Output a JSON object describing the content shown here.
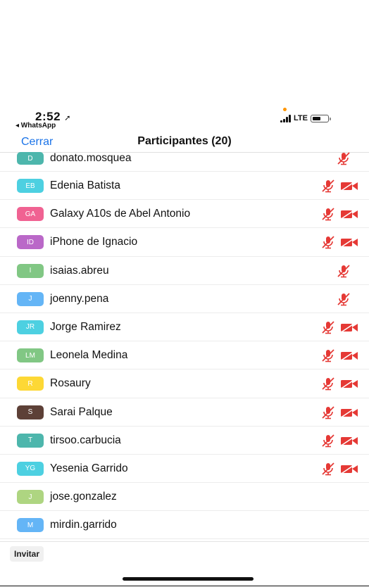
{
  "status": {
    "time": "2:52",
    "location_glyph": "➚",
    "back_app": "◂ WhatsApp",
    "network": "LTE",
    "battery_level": 0.55
  },
  "nav": {
    "close_label": "Cerrar",
    "title": "Participantes (20)"
  },
  "colors": {
    "accent": "#1a73e8",
    "muted_red": "#e53935"
  },
  "participants": [
    {
      "initials": "D",
      "name": "donato.mosquea",
      "avatar_color": "#4db6ac",
      "mic_muted": true,
      "video_off": false
    },
    {
      "initials": "EB",
      "name": "Edenia Batista",
      "avatar_color": "#4dd0e1",
      "mic_muted": true,
      "video_off": true
    },
    {
      "initials": "GA",
      "name": "Galaxy A10s de Abel Antonio",
      "avatar_color": "#f06292",
      "mic_muted": true,
      "video_off": true
    },
    {
      "initials": "ID",
      "name": "iPhone de Ignacio",
      "avatar_color": "#ba68c8",
      "mic_muted": true,
      "video_off": true
    },
    {
      "initials": "I",
      "name": "isaias.abreu",
      "avatar_color": "#81c784",
      "mic_muted": true,
      "video_off": false
    },
    {
      "initials": "J",
      "name": "joenny.pena",
      "avatar_color": "#64b5f6",
      "mic_muted": true,
      "video_off": false
    },
    {
      "initials": "JR",
      "name": "Jorge Ramirez",
      "avatar_color": "#4dd0e1",
      "mic_muted": true,
      "video_off": true
    },
    {
      "initials": "LM",
      "name": "Leonela Medina",
      "avatar_color": "#81c784",
      "mic_muted": true,
      "video_off": true
    },
    {
      "initials": "R",
      "name": "Rosaury",
      "avatar_color": "#fdd835",
      "mic_muted": true,
      "video_off": true
    },
    {
      "initials": "S",
      "name": "Sarai Palque",
      "avatar_color": "#5d4037",
      "mic_muted": true,
      "video_off": true
    },
    {
      "initials": "T",
      "name": "tirsoo.carbucia",
      "avatar_color": "#4db6ac",
      "mic_muted": true,
      "video_off": true
    },
    {
      "initials": "YG",
      "name": "Yesenia Garrido",
      "avatar_color": "#4dd0e1",
      "mic_muted": true,
      "video_off": true
    },
    {
      "initials": "J",
      "name": "jose.gonzalez",
      "avatar_color": "#aed581",
      "mic_muted": false,
      "video_off": false
    },
    {
      "initials": "M",
      "name": "mirdin.garrido",
      "avatar_color": "#64b5f6",
      "mic_muted": false,
      "video_off": false
    }
  ],
  "footer": {
    "invite_label": "Invitar"
  }
}
